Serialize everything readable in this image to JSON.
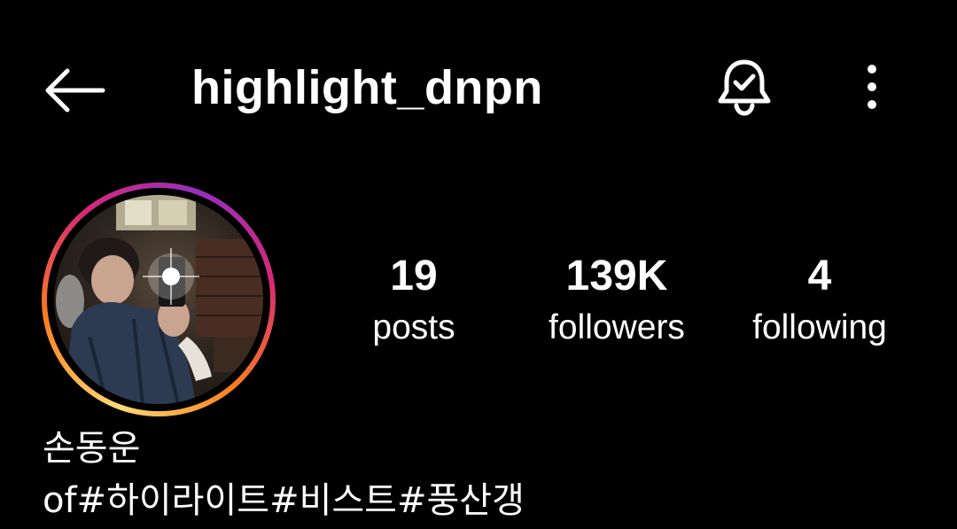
{
  "header": {
    "username": "highlight_dnpn",
    "back_icon": "arrow-left-icon",
    "bell_icon": "bell-check-icon",
    "more_icon": "more-vertical-icon"
  },
  "profile": {
    "avatar_ring_colors": [
      "#feda75",
      "#fa7e1e",
      "#d62976",
      "#962fbf"
    ],
    "stats": {
      "posts": {
        "count": "19",
        "label": "posts"
      },
      "followers": {
        "count": "139K",
        "label": "followers"
      },
      "following": {
        "count": "4",
        "label": "following"
      }
    },
    "display_name": "손동운",
    "bio": "of#하이라이트#비스트#풍산갱"
  }
}
